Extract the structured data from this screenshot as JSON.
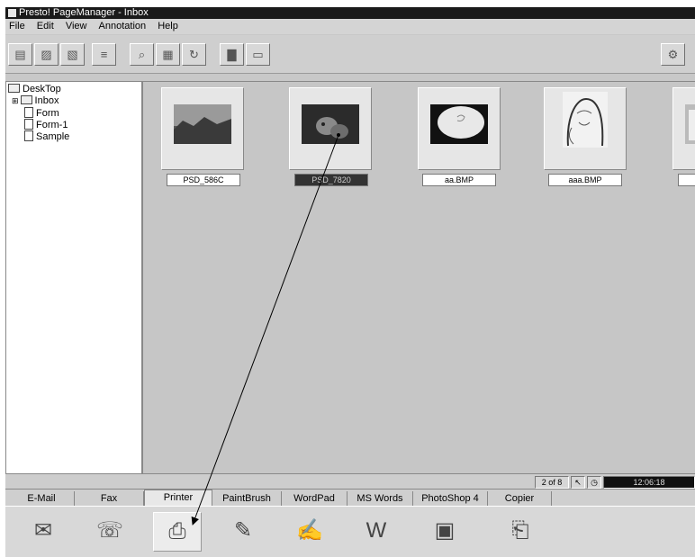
{
  "window": {
    "title": "Presto! PageManager - Inbox"
  },
  "menu": [
    "File",
    "Edit",
    "View",
    "Annotation",
    "Help"
  ],
  "tree": {
    "root": "DeskTop",
    "items": [
      "Inbox",
      "Form",
      "Form-1",
      "Sample"
    ]
  },
  "thumbnails": [
    {
      "label": "PSD_586C",
      "image": "landscape-photo",
      "selected": false
    },
    {
      "label": "PSD_7820",
      "image": "cat-photo",
      "selected": true
    },
    {
      "label": "aa.BMP",
      "image": "sketch-image",
      "selected": false
    },
    {
      "label": "aaa.BMP",
      "image": "portrait-drawing",
      "selected": false
    },
    {
      "label": "m",
      "image": "partial-image",
      "selected": false
    }
  ],
  "status": {
    "count": "2 of 8",
    "clock": "12:06:18"
  },
  "tabs": [
    "E-Mail",
    "Fax",
    "Printer",
    "PaintBrush",
    "WordPad",
    "MS Words",
    "PhotoShop 4",
    "Copier"
  ],
  "active_tab": "Printer",
  "apps": [
    {
      "name": "email-icon",
      "glyph": "✉"
    },
    {
      "name": "fax-icon",
      "glyph": "☏"
    },
    {
      "name": "printer-icon",
      "glyph": "⎙"
    },
    {
      "name": "paintbrush-icon",
      "glyph": "✎"
    },
    {
      "name": "wordpad-icon",
      "glyph": "✍"
    },
    {
      "name": "ms-words-icon",
      "glyph": "W"
    },
    {
      "name": "photoshop-icon",
      "glyph": "▣"
    },
    {
      "name": "copier-icon",
      "glyph": "⎗"
    }
  ]
}
